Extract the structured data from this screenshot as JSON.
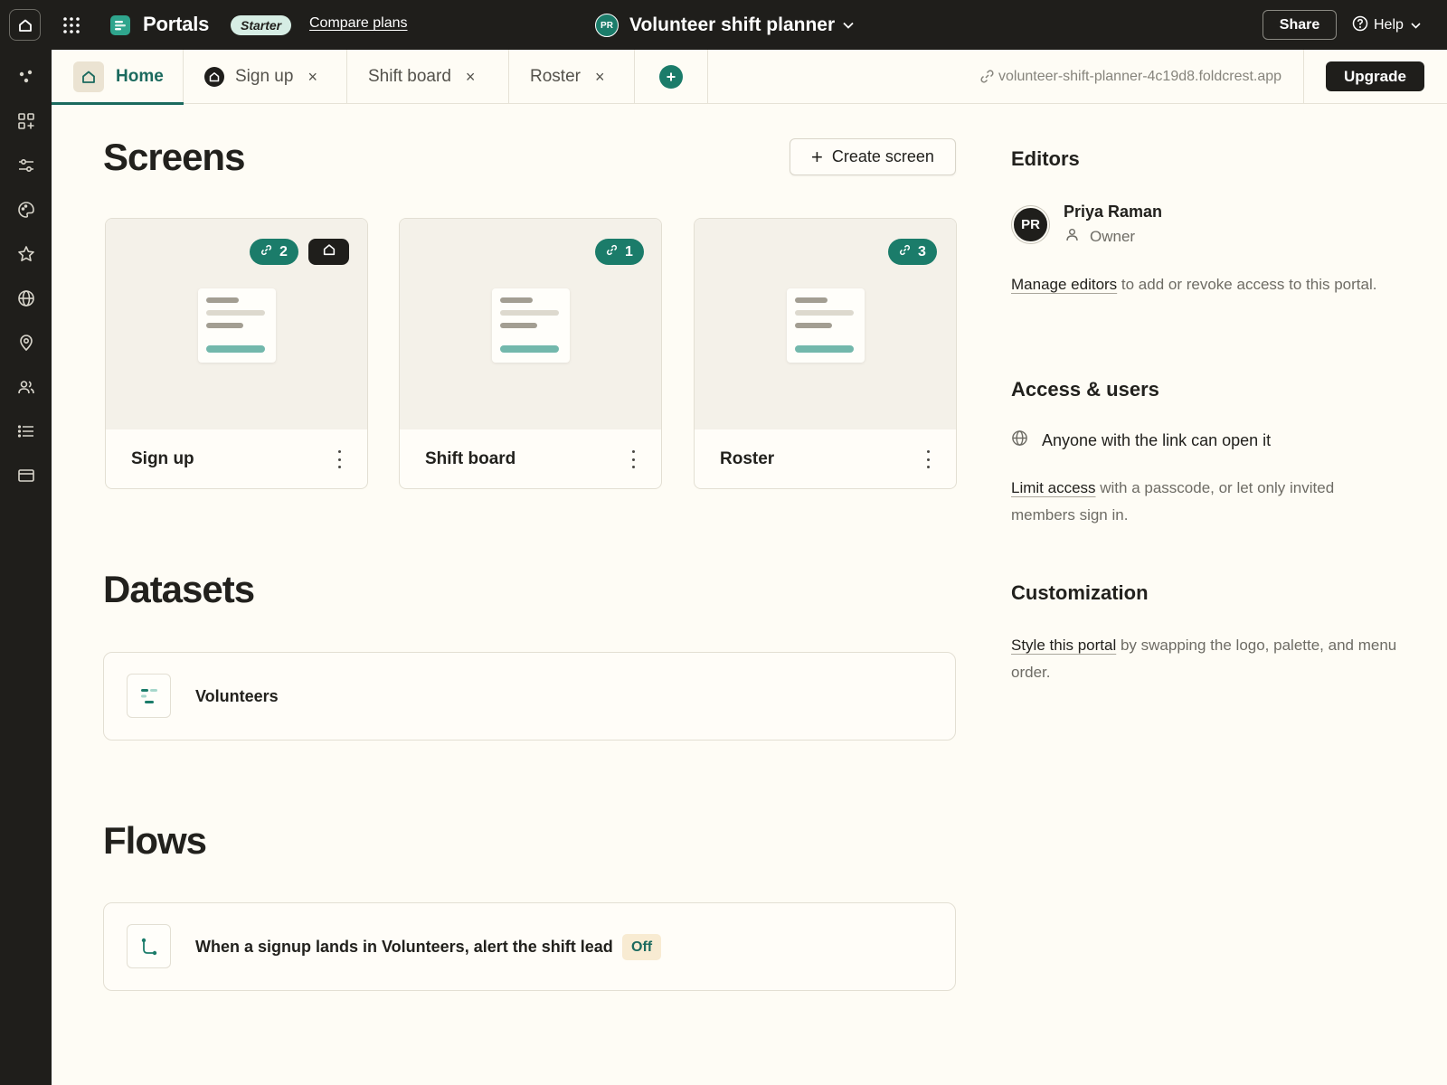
{
  "topbar": {
    "app_name": "Portals",
    "plan_badge": "Starter",
    "compare_plans": "Compare plans",
    "project_avatar": "PR",
    "project_name": "Volunteer shift planner",
    "share": "Share",
    "help": "Help"
  },
  "rail": {
    "icons": [
      "dots-icon",
      "apps-icon",
      "sliders-icon",
      "palette-icon",
      "star-icon",
      "globe-icon",
      "location-pin-icon",
      "users-icon",
      "list-icon",
      "card-icon"
    ]
  },
  "tabs": {
    "home": "Home",
    "signup": "Sign up",
    "shift_board": "Shift board",
    "roster": "Roster",
    "close_glyph": "×",
    "url": "volunteer-shift-planner-4c19d8.foldcrest.app",
    "upgrade": "Upgrade"
  },
  "screens": {
    "heading": "Screens",
    "create_label": "Create screen",
    "create_glyph": "+",
    "cards": [
      {
        "title": "Sign up",
        "link_count": "2",
        "is_home": true
      },
      {
        "title": "Shift board",
        "link_count": "1",
        "is_home": false
      },
      {
        "title": "Roster",
        "link_count": "3",
        "is_home": false
      }
    ]
  },
  "datasets": {
    "heading": "Datasets",
    "items": [
      {
        "name": "Volunteers"
      }
    ]
  },
  "flows": {
    "heading": "Flows",
    "items": [
      {
        "name": "When a signup lands in Volunteers, alert the shift lead",
        "status": "Off"
      }
    ]
  },
  "editors": {
    "heading": "Editors",
    "avatar": "PR",
    "name": "Priya Raman",
    "role": "Owner",
    "manage_link": "Manage editors",
    "manage_text": " to add or revoke access to this portal."
  },
  "access": {
    "heading": "Access & users",
    "status": "Anyone with the link can open it",
    "limit_link": "Limit access",
    "limit_text": " with a passcode, or let only invited members sign in."
  },
  "customization": {
    "heading": "Customization",
    "style_link": "Style this portal",
    "style_text": " by swapping the logo, palette, and menu order."
  },
  "colors": {
    "accent": "#1b7c6a",
    "dark": "#1f1e1b",
    "background": "#fefcf5",
    "off_badge_bg": "#f8ebd2"
  }
}
